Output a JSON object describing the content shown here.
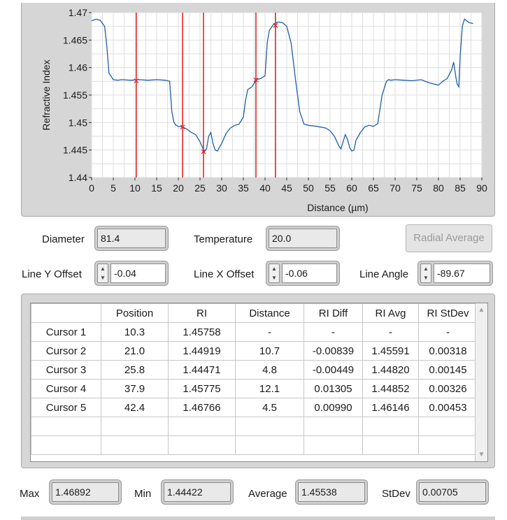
{
  "chart": {
    "ylabel": "Refractive Index",
    "xlabel": "Distance (µm)",
    "xlim": [
      0,
      90
    ],
    "ylim": [
      1.44,
      1.47
    ],
    "x_ticks": [
      0,
      5,
      10,
      15,
      20,
      25,
      30,
      35,
      40,
      45,
      50,
      55,
      60,
      65,
      70,
      75,
      80,
      85,
      90
    ],
    "y_ticks": [
      "1.44",
      "1.445",
      "1.45",
      "1.455",
      "1.46",
      "1.465",
      "1.47"
    ],
    "cursor_positions": [
      10.3,
      21.0,
      25.8,
      37.9,
      42.4
    ],
    "colors": {
      "line": "#1f5fa8",
      "cursor": "#e0282c",
      "plot_bg": "#ffffff",
      "panel": "#d6d6d6"
    }
  },
  "chart_data": {
    "type": "line",
    "title": "",
    "xlabel": "Distance (µm)",
    "ylabel": "Refractive Index",
    "xlim": [
      0,
      90
    ],
    "ylim": [
      1.44,
      1.47
    ],
    "grid": true,
    "series": [
      {
        "x": [
          0,
          1,
          2,
          3,
          3.5,
          4,
          5,
          6,
          7,
          9,
          11,
          13,
          15,
          17,
          18,
          18.5,
          19,
          19.5,
          20,
          21,
          22,
          23,
          24,
          25,
          26,
          26.5,
          27,
          27.5,
          28,
          28.5,
          29,
          29.5,
          30,
          31,
          32,
          33,
          34,
          35,
          35.5,
          36,
          37,
          38,
          39,
          40,
          40.5,
          41,
          42,
          43,
          44,
          45,
          46,
          47,
          48,
          49,
          50,
          52,
          54,
          55,
          56,
          57,
          57.5,
          58,
          58.5,
          59,
          59.5,
          60,
          60.5,
          61,
          62,
          63,
          64,
          65,
          66,
          67,
          68,
          68.5,
          69,
          70,
          72,
          74,
          76,
          78,
          80,
          81,
          82,
          83,
          83.5,
          84,
          84.3,
          84.7,
          85,
          85.5,
          86,
          87,
          88
        ],
        "values": [
          1.4685,
          1.4688,
          1.4686,
          1.4675,
          1.464,
          1.459,
          1.4578,
          1.4577,
          1.4578,
          1.4577,
          1.4578,
          1.4577,
          1.4578,
          1.4577,
          1.4575,
          1.452,
          1.45,
          1.4495,
          1.4493,
          1.4492,
          1.4488,
          1.4482,
          1.4478,
          1.4465,
          1.4447,
          1.4452,
          1.4475,
          1.4482,
          1.4462,
          1.445,
          1.4448,
          1.4455,
          1.4462,
          1.448,
          1.449,
          1.4495,
          1.4497,
          1.451,
          1.454,
          1.456,
          1.4565,
          1.4578,
          1.458,
          1.4585,
          1.4645,
          1.4668,
          1.4679,
          1.4683,
          1.4682,
          1.4675,
          1.4645,
          1.458,
          1.452,
          1.4497,
          1.4495,
          1.4493,
          1.449,
          1.4485,
          1.4475,
          1.4458,
          1.4452,
          1.4465,
          1.4478,
          1.447,
          1.4455,
          1.4448,
          1.445,
          1.4468,
          1.4482,
          1.4492,
          1.4495,
          1.4493,
          1.4498,
          1.455,
          1.4575,
          1.4578,
          1.4577,
          1.4578,
          1.4577,
          1.4576,
          1.4578,
          1.4572,
          1.4568,
          1.4575,
          1.458,
          1.4595,
          1.461,
          1.4583,
          1.457,
          1.4565,
          1.462,
          1.4675,
          1.4688,
          1.4682,
          1.468
        ]
      }
    ]
  },
  "params": {
    "diameter_label": "Diameter",
    "diameter_value": "81.4",
    "temperature_label": "Temperature",
    "temperature_value": "20.0",
    "radial_button": "Radial Average",
    "line_y_label": "Line Y Offset",
    "line_y_value": "-0.04",
    "line_x_label": "Line X Offset",
    "line_x_value": "-0.06",
    "line_angle_label": "Line Angle",
    "line_angle_value": "-89.67"
  },
  "table": {
    "headers": [
      "",
      "Position",
      "RI",
      "Distance",
      "RI Diff",
      "RI Avg",
      "RI StDev"
    ],
    "rows": [
      [
        "Cursor 1",
        "10.3",
        "1.45758",
        "-",
        "-",
        "-",
        "-"
      ],
      [
        "Cursor 2",
        "21.0",
        "1.44919",
        "10.7",
        "-0.00839",
        "1.45591",
        "0.00318"
      ],
      [
        "Cursor 3",
        "25.8",
        "1.44471",
        "4.8",
        "-0.00449",
        "1.44820",
        "0.00145"
      ],
      [
        "Cursor 4",
        "37.9",
        "1.45775",
        "12.1",
        "0.01305",
        "1.44852",
        "0.00326"
      ],
      [
        "Cursor 5",
        "42.4",
        "1.46766",
        "4.5",
        "0.00990",
        "1.46146",
        "0.00453"
      ],
      [
        "",
        "",
        "",
        "",
        "",
        "",
        ""
      ],
      [
        "",
        "",
        "",
        "",
        "",
        "",
        ""
      ]
    ]
  },
  "stats": {
    "max_label": "Max",
    "max_value": "1.46892",
    "min_label": "Min",
    "min_value": "1.44422",
    "avg_label": "Average",
    "avg_value": "1.45538",
    "stdev_label": "StDev",
    "stdev_value": "0.00705"
  }
}
